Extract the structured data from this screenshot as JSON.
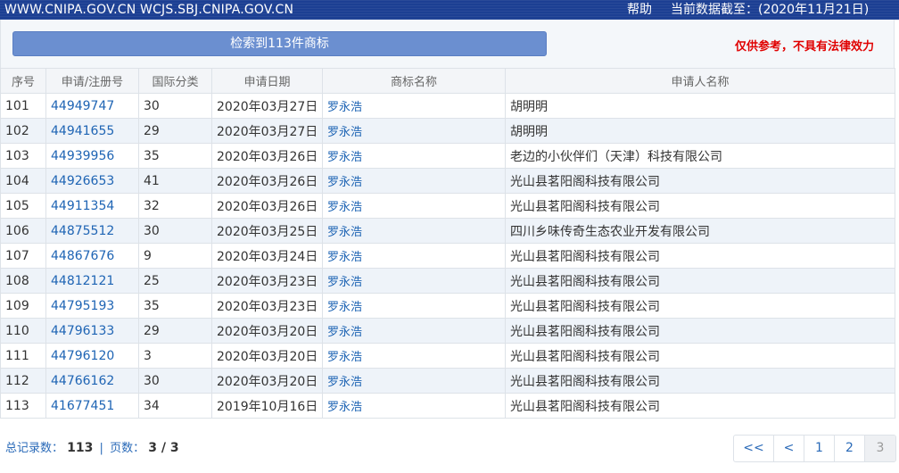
{
  "topbar": {
    "site": "WWW.CNIPA.GOV.CN WCJS.SBJ.CNIPA.GOV.CN",
    "help": "帮助",
    "as_of": "当前数据截至：(2020年11月21日)"
  },
  "panel": {
    "search_button": "检索到113件商标",
    "disclaimer": "仅供参考，不具有法律效力"
  },
  "table": {
    "headers": [
      "序号",
      "申请/注册号",
      "国际分类",
      "申请日期",
      "商标名称",
      "申请人名称"
    ],
    "rows": [
      [
        "101",
        "44949747",
        "30",
        "2020年03月27日",
        "罗永浩",
        "胡明明"
      ],
      [
        "102",
        "44941655",
        "29",
        "2020年03月27日",
        "罗永浩",
        "胡明明"
      ],
      [
        "103",
        "44939956",
        "35",
        "2020年03月26日",
        "罗永浩",
        "老边的小伙伴们（天津）科技有限公司"
      ],
      [
        "104",
        "44926653",
        "41",
        "2020年03月26日",
        "罗永浩",
        "光山县茗阳阁科技有限公司"
      ],
      [
        "105",
        "44911354",
        "32",
        "2020年03月26日",
        "罗永浩",
        "光山县茗阳阁科技有限公司"
      ],
      [
        "106",
        "44875512",
        "30",
        "2020年03月25日",
        "罗永浩",
        "四川乡味传奇生态农业开发有限公司"
      ],
      [
        "107",
        "44867676",
        "9",
        "2020年03月24日",
        "罗永浩",
        "光山县茗阳阁科技有限公司"
      ],
      [
        "108",
        "44812121",
        "25",
        "2020年03月23日",
        "罗永浩",
        "光山县茗阳阁科技有限公司"
      ],
      [
        "109",
        "44795193",
        "35",
        "2020年03月23日",
        "罗永浩",
        "光山县茗阳阁科技有限公司"
      ],
      [
        "110",
        "44796133",
        "29",
        "2020年03月20日",
        "罗永浩",
        "光山县茗阳阁科技有限公司"
      ],
      [
        "111",
        "44796120",
        "3",
        "2020年03月20日",
        "罗永浩",
        "光山县茗阳阁科技有限公司"
      ],
      [
        "112",
        "44766162",
        "30",
        "2020年03月20日",
        "罗永浩",
        "光山县茗阳阁科技有限公司"
      ],
      [
        "113",
        "41677451",
        "34",
        "2019年10月16日",
        "罗永浩",
        "光山县茗阳阁科技有限公司"
      ]
    ]
  },
  "footer": {
    "total_label": "总记录数：",
    "total_value": "113",
    "separator": "|",
    "pages_label": "页数：",
    "pages_value": "3 / 3"
  },
  "pager": {
    "first": "<<",
    "prev": "<",
    "pages": [
      "1",
      "2",
      "3"
    ],
    "current": "3"
  }
}
